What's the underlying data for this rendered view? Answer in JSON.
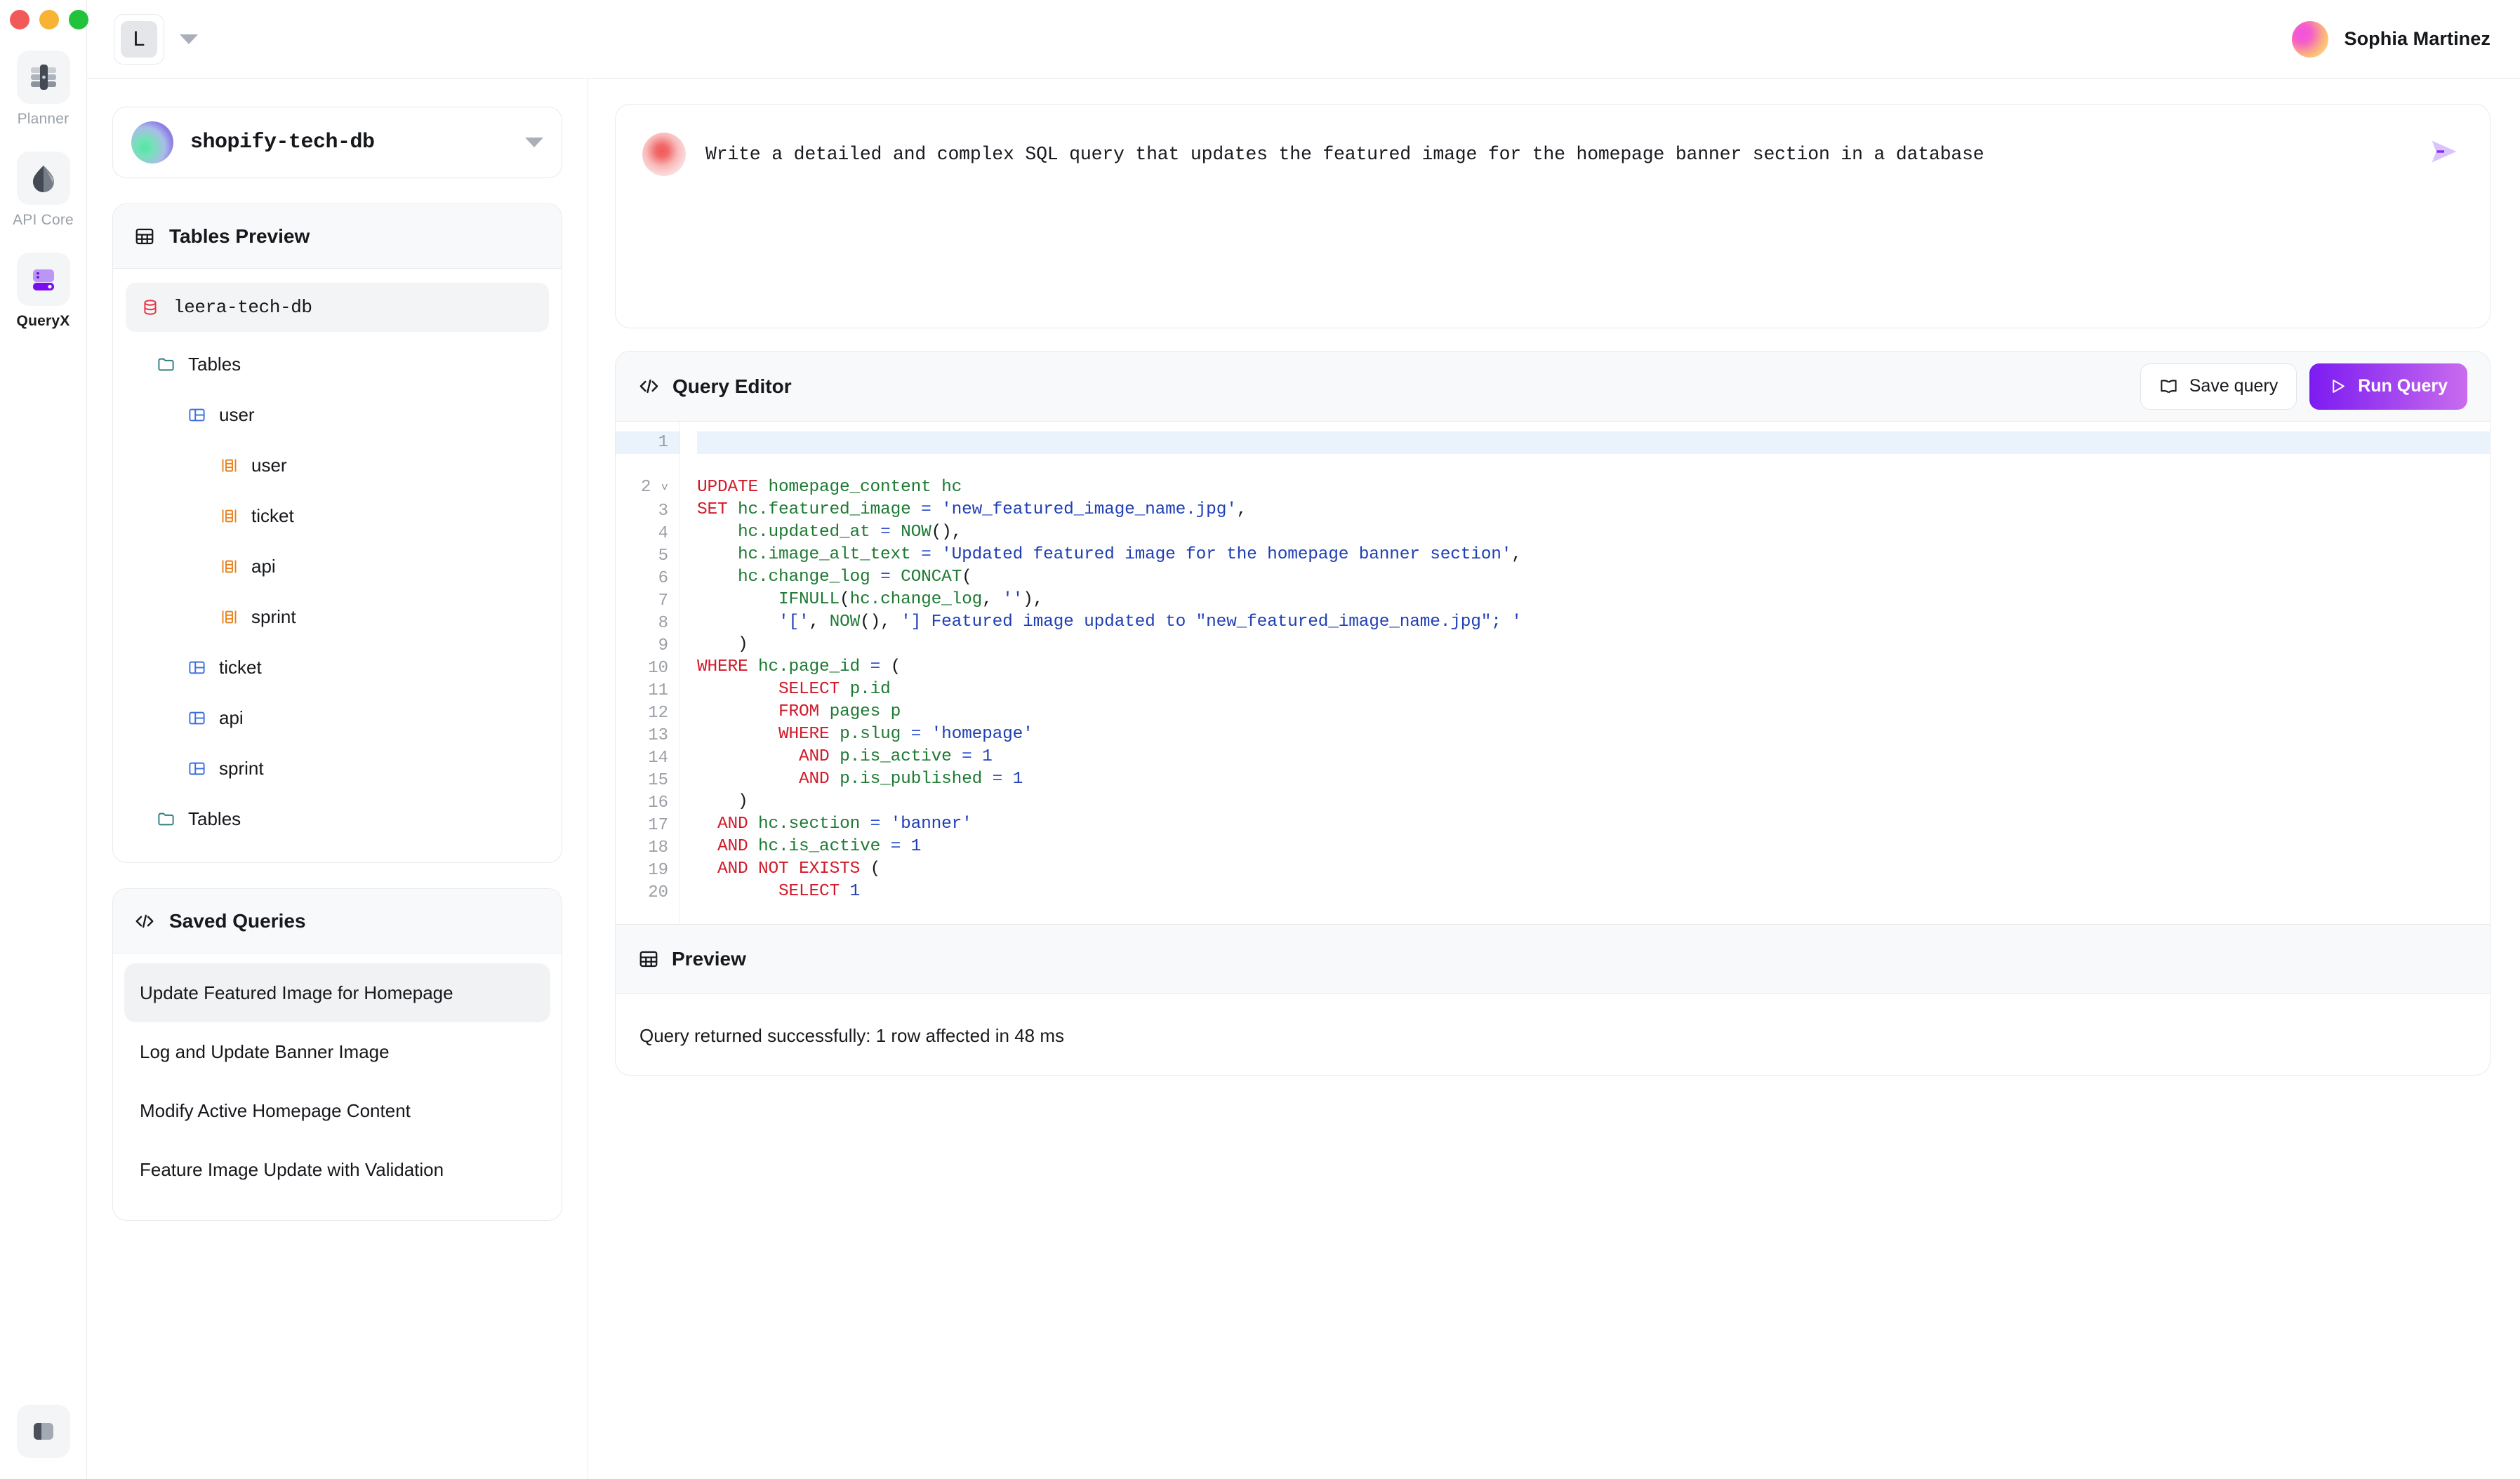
{
  "window": {
    "traffic_lights": [
      "close",
      "minimize",
      "maximize"
    ]
  },
  "rail": {
    "items": [
      {
        "label": "Planner",
        "icon": "server-stack-icon",
        "active": false
      },
      {
        "label": "API Core",
        "icon": "droplet-split-icon",
        "active": false
      },
      {
        "label": "QueryX",
        "icon": "database-purple-icon",
        "active": true
      }
    ],
    "bottom": {
      "label": "sidebar-toggle",
      "icon": "panel-toggle-icon"
    }
  },
  "topbar": {
    "workspace_initial": "L",
    "workspace_caret": "chevron-down-icon",
    "user": {
      "name": "Sophia Martinez",
      "avatar": "user-avatar"
    }
  },
  "sidebar": {
    "db_selector": {
      "value": "shopify-tech-db",
      "caret": "chevron-down-icon",
      "orb": "database-orb"
    },
    "tables_preview": {
      "title": "Tables Preview",
      "icon": "table-grid-icon",
      "database": {
        "label": "leera-tech-db",
        "icon": "database-icon"
      },
      "tree": [
        {
          "label": "Tables",
          "icon": "folder-icon",
          "depth": 1
        },
        {
          "label": "user",
          "icon": "table-icon",
          "depth": 2
        },
        {
          "label": "user",
          "icon": "columns-icon",
          "depth": 3
        },
        {
          "label": "ticket",
          "icon": "columns-icon",
          "depth": 3
        },
        {
          "label": "api",
          "icon": "columns-icon",
          "depth": 3
        },
        {
          "label": "sprint",
          "icon": "columns-icon",
          "depth": 3
        },
        {
          "label": "ticket",
          "icon": "table-icon",
          "depth": 2
        },
        {
          "label": "api",
          "icon": "table-icon",
          "depth": 2
        },
        {
          "label": "sprint",
          "icon": "table-icon",
          "depth": 2
        },
        {
          "label": "Tables",
          "icon": "folder-icon",
          "depth": 1
        }
      ]
    },
    "saved_queries": {
      "title": "Saved Queries",
      "icon": "code-brackets-icon",
      "items": [
        {
          "label": "Update Featured Image for Homepage",
          "selected": true
        },
        {
          "label": "Log and Update Banner Image",
          "selected": false
        },
        {
          "label": "Modify Active Homepage Content",
          "selected": false
        },
        {
          "label": "Feature Image Update with Validation",
          "selected": false
        }
      ]
    }
  },
  "prompt": {
    "text": "Write a detailed and complex SQL query that updates the featured image for the homepage banner section in a database",
    "send_icon": "send-icon",
    "orb": "assistant-orb"
  },
  "editor": {
    "title": "Query Editor",
    "icon": "code-brackets-icon",
    "save_label": "Save query",
    "save_icon": "book-icon",
    "run_label": "Run Query",
    "run_icon": "play-icon",
    "accent_gradient_from": "#7C1BF0",
    "accent_gradient_to": "#C96CEE",
    "line_numbers": [
      1,
      2,
      3,
      4,
      5,
      6,
      7,
      8,
      9,
      10,
      11,
      12,
      13,
      14,
      15,
      16,
      17,
      18,
      19,
      20
    ],
    "active_line": 1,
    "fold_marker_line": 2,
    "sql_lines": [
      "",
      "UPDATE homepage_content hc",
      "SET hc.featured_image = 'new_featured_image_name.jpg',",
      "    hc.updated_at = NOW(),",
      "    hc.image_alt_text = 'Updated featured image for the homepage banner section',",
      "    hc.change_log = CONCAT(",
      "        IFNULL(hc.change_log, ''),",
      "        '[', NOW(), '] Featured image updated to \"new_featured_image_name.jpg\"; '",
      "    )",
      "WHERE hc.page_id = (",
      "        SELECT p.id",
      "        FROM pages p",
      "        WHERE p.slug = 'homepage'",
      "          AND p.is_active = 1",
      "          AND p.is_published = 1",
      "    )",
      "  AND hc.section = 'banner'",
      "  AND hc.is_active = 1",
      "  AND NOT EXISTS (",
      "        SELECT 1"
    ]
  },
  "preview": {
    "title": "Preview",
    "icon": "table-grid-icon",
    "message": "Query returned successfully: 1 row affected in 48 ms"
  }
}
